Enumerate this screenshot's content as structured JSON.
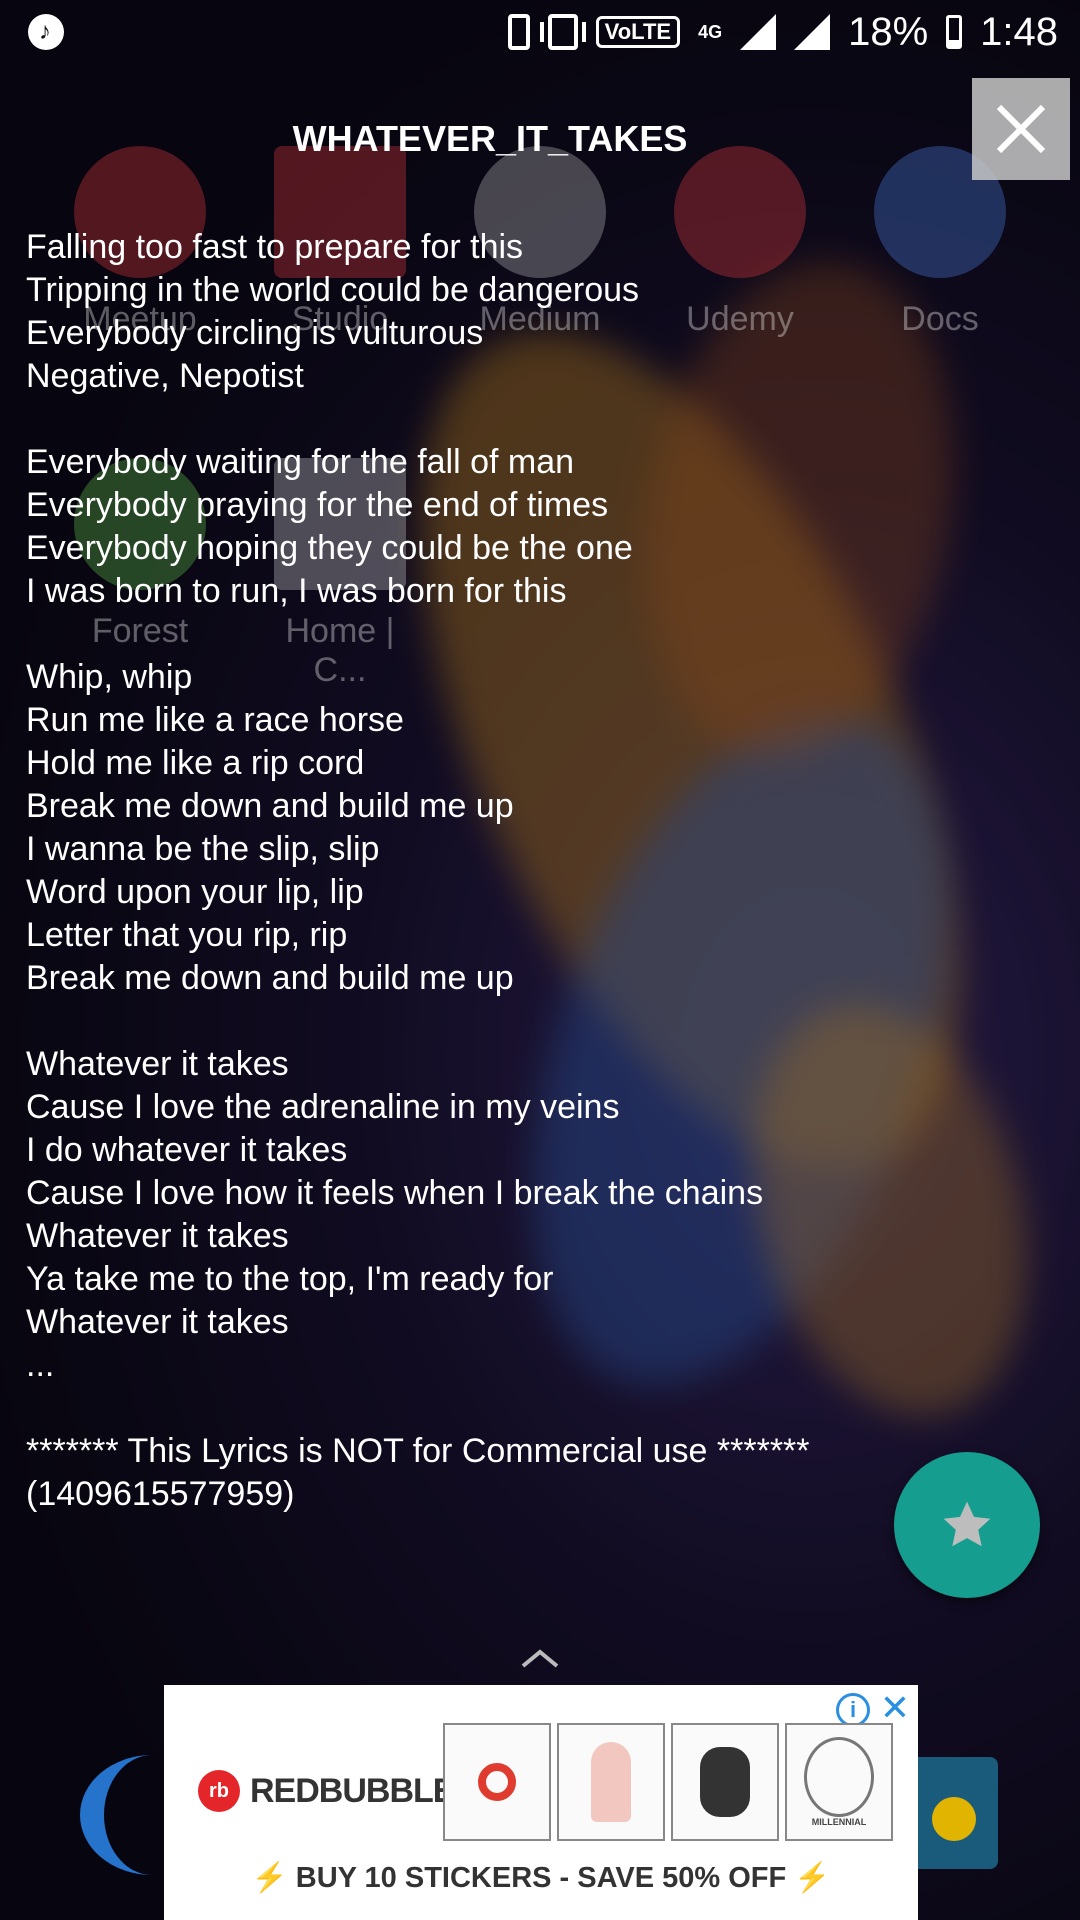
{
  "status_bar": {
    "music_icon": "music-note",
    "volte": "VoLTE",
    "network": "4G",
    "battery": "18%",
    "time": "1:48"
  },
  "home_apps": [
    {
      "label": "Meetup",
      "color": "#e0393e"
    },
    {
      "label": "Studio",
      "color": "#e0393e"
    },
    {
      "label": "Medium",
      "color": "#bbbbbb"
    },
    {
      "label": "Udemy",
      "color": "#e0393e"
    },
    {
      "label": "Docs",
      "color": "#4a7fe0"
    },
    {
      "label": "Forest",
      "color": "#5fbf4a"
    },
    {
      "label": "Home | C...",
      "color": "#cccccc"
    }
  ],
  "lyrics_popup": {
    "title": "WHATEVER_IT_TAKES",
    "lyrics": "Falling too fast to prepare for this\nTripping in the world could be dangerous\nEverybody circling is vulturous\nNegative, Nepotist\n\nEverybody waiting for the fall of man\nEverybody praying for the end of times\nEverybody hoping they could be the one\nI was born to run, I was born for this\n\nWhip, whip\nRun me like a race horse\nHold me like a rip cord\nBreak me down and build me up\nI wanna be the slip, slip\nWord upon your lip, lip\nLetter that you rip, rip\nBreak me down and build me up\n\nWhatever it takes\nCause I love the adrenaline in my veins\nI do whatever it takes\nCause I love how it feels when I break the chains\nWhatever it takes\nYa take me to the top, I'm ready for\nWhatever it takes\n...",
    "footer": "******* This Lyrics is NOT for Commercial use *******\n(1409615577959)",
    "close_icon": "close-x",
    "favorite_icon": "star"
  },
  "ad": {
    "brand": "REDBUBBLE",
    "brand_mark": "rb",
    "cta": "BUY 10 STICKERS - SAVE 50% OFF",
    "info_icon": "i",
    "close_icon": "✕",
    "thumbnails": [
      "chrome-dino-stickers",
      "girl-sticker",
      "character-sticker",
      "millennial-falcon-sticker"
    ],
    "thumb_label": "MILLENNIAL"
  },
  "colors": {
    "fab": "#159e8f",
    "ad_accent": "#e4262b",
    "ad_info": "#2a8fe0"
  }
}
